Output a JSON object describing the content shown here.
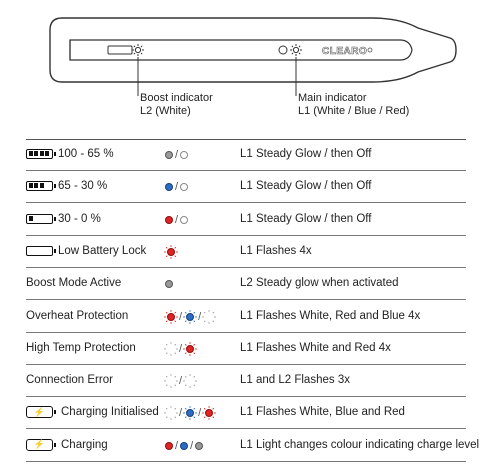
{
  "device": {
    "brand": "CLEARO",
    "boost_label": "Boost indicator",
    "boost_detail": "L2 (White)",
    "main_label": "Main indicator",
    "main_detail": "L1 (White / Blue / Red)"
  },
  "rows": [
    {
      "condition": "100 - 65 %",
      "icon": "battery-full-icon",
      "indicator": [
        "grey",
        "off"
      ],
      "description": "L1 Steady Glow / then Off"
    },
    {
      "condition": "65 - 30 %",
      "icon": "battery-medium-icon",
      "indicator": [
        "blue",
        "off"
      ],
      "description": "L1 Steady Glow / then Off"
    },
    {
      "condition": "30 - 0 %",
      "icon": "battery-low-icon",
      "indicator": [
        "red",
        "off"
      ],
      "description": "L1 Steady Glow / then Off"
    },
    {
      "condition": "Low Battery Lock",
      "icon": "battery-empty-icon",
      "indicator": [
        "red-glow"
      ],
      "description": "L1 Flashes 4x"
    },
    {
      "condition": "Boost Mode Active",
      "icon": "",
      "indicator": [
        "grey"
      ],
      "description": "L2 Steady glow when activated"
    },
    {
      "condition": "Overheat Protection",
      "icon": "",
      "indicator": [
        "red-glow",
        "blue-glow",
        "white-glow"
      ],
      "description": "L1 Flashes White, Red and Blue 4x"
    },
    {
      "condition": "High Temp Protection",
      "icon": "",
      "indicator": [
        "white-glow",
        "red-glow"
      ],
      "description": "L1 Flashes White and Red 4x"
    },
    {
      "condition": "Connection Error",
      "icon": "",
      "indicator": [
        "white-glow",
        "white-glow"
      ],
      "description": "L1 and L2 Flashes 3x"
    },
    {
      "condition": "Charging Initialised",
      "icon": "charging-icon",
      "indicator": [
        "white-glow",
        "blue-glow",
        "red-glow"
      ],
      "description": "L1 Flashes White, Blue and Red"
    },
    {
      "condition": "Charging",
      "icon": "charging-icon",
      "indicator": [
        "red",
        "blue",
        "grey"
      ],
      "description": "L1 Light changes colour indicating charge level"
    }
  ]
}
